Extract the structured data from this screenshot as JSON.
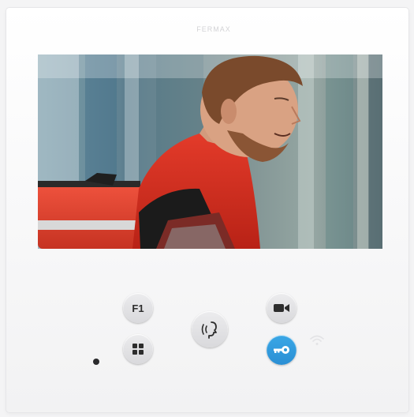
{
  "device": {
    "brand_label": "FERMAX",
    "colors": {
      "panel": "#f7f7f8",
      "button_gray": "#dcdcdf",
      "button_blue": "#2f9ad8"
    }
  },
  "screen": {
    "content": "courier-visitor-video-feed"
  },
  "buttons": {
    "f1": {
      "label": "F1",
      "icon": "f1-text"
    },
    "menu": {
      "icon": "grid-icon"
    },
    "talk": {
      "icon": "speaking-head-icon"
    },
    "camera": {
      "icon": "video-camera-icon"
    },
    "door": {
      "icon": "key-icon"
    }
  },
  "indicators": {
    "status_led": {
      "state": "off"
    },
    "wifi": {
      "icon": "wifi-icon",
      "state": "idle"
    }
  }
}
